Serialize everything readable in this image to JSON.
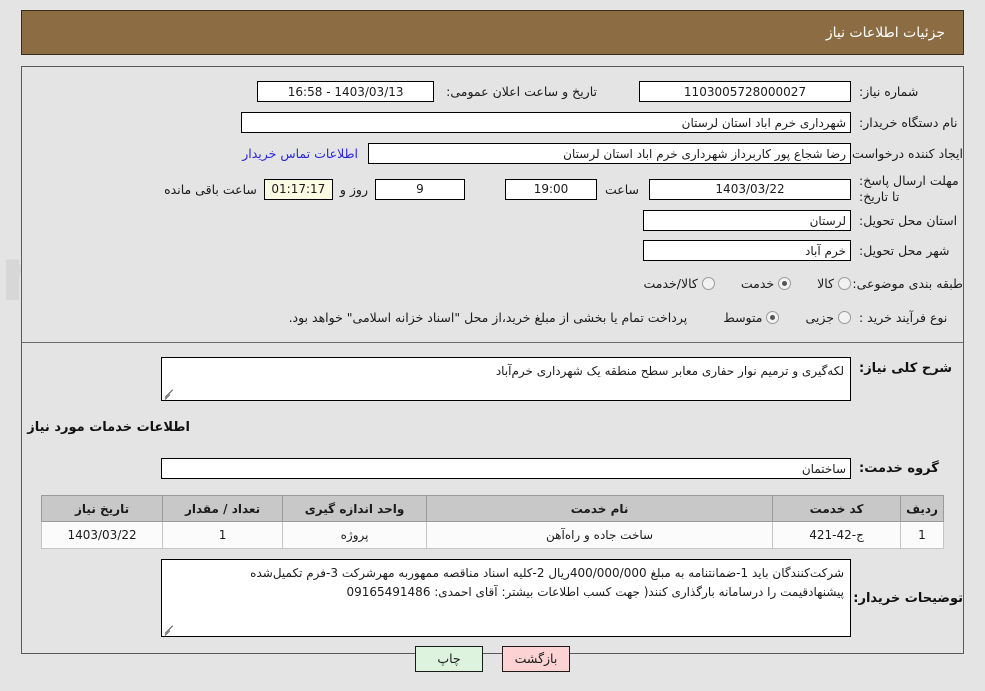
{
  "header": {
    "title": "جزئیات اطلاعات نیاز"
  },
  "form": {
    "need_number_label": "شماره نیاز:",
    "need_number_value": "1103005728000027",
    "public_announce_label": "تاریخ و ساعت اعلان عمومی:",
    "public_announce_value": "1403/03/13 - 16:58",
    "buyer_org_label": "نام دستگاه خریدار:",
    "buyer_org_value": "شهرداری خرم اباد استان لرستان",
    "requester_label": "ایجاد کننده درخواست:",
    "requester_value": "رضا شجاع پور کاربرداز شهرداری خرم اباد استان لرستان",
    "contact_link": "اطلاعات تماس خریدار",
    "deadline_label": "مهلت ارسال پاسخ: تا تاریخ:",
    "deadline_date": "1403/03/22",
    "deadline_hour_label": "ساعت",
    "deadline_hour": "19:00",
    "remaining_days": "9",
    "days_and_label": "روز و",
    "remaining_time": "01:17:17",
    "remaining_suffix": "ساعت باقی مانده",
    "province_label": "استان محل تحویل:",
    "province_value": "لرستان",
    "city_label": "شهر محل تحویل:",
    "city_value": "خرم آباد",
    "category_label": "طبقه بندی موضوعی:",
    "category_options": [
      {
        "label": "کالا",
        "selected": false
      },
      {
        "label": "خدمت",
        "selected": true
      },
      {
        "label": "کالا/خدمت",
        "selected": false
      }
    ],
    "process_label": "نوع فرآیند خرید :",
    "process_options": [
      {
        "label": "جزیی",
        "selected": false
      },
      {
        "label": "متوسط",
        "selected": true
      }
    ],
    "process_note": "پرداخت تمام یا بخشی از مبلغ خرید،از محل \"اسناد خزانه اسلامی\" خواهد بود."
  },
  "description": {
    "label": "شرح کلی نیاز:",
    "value": "لکه‌گیری و ترمیم نوار حفاری معابر سطح منطقه یک شهرداری خرم‌آباد"
  },
  "services_section": {
    "heading": "اطلاعات خدمات مورد نیاز",
    "group_label": "گروه خدمت:",
    "group_value": "ساختمان"
  },
  "table": {
    "headers": [
      "ردیف",
      "کد خدمت",
      "نام خدمت",
      "واحد اندازه گیری",
      "تعداد / مقدار",
      "تاریخ نیاز"
    ],
    "rows": [
      {
        "index": "1",
        "code": "ج-42-421",
        "name": "ساخت جاده و راه‌آهن",
        "unit": "پروژه",
        "quantity": "1",
        "date": "1403/03/22"
      }
    ]
  },
  "buyer_notes": {
    "label": "توضیحات خریدار:",
    "line1": "شرکت‌کنندگان باید 1-ضمانتنامه به مبلغ 400/000/000ریال 2-کلیه اسناد مناقصه ممهوربه مهرشرکت 3-فرم تکمیل‌شده",
    "line2": "پیشنهادقیمت را درسامانه بارگذاری کنند( جهت کسب اطلاعات بیشتر: آقای احمدی: 09165491486"
  },
  "footer": {
    "print": "چاپ",
    "back": "بازگشت"
  },
  "colors": {
    "header_bg": "#8b6c43",
    "page_bg": "#e4e4e4",
    "link": "#2828d8",
    "print_btn": "#ddf3dd",
    "back_btn": "#fcd2d2",
    "table_header": "#c8c8c8",
    "countdown_bg": "#fbfbe3"
  }
}
